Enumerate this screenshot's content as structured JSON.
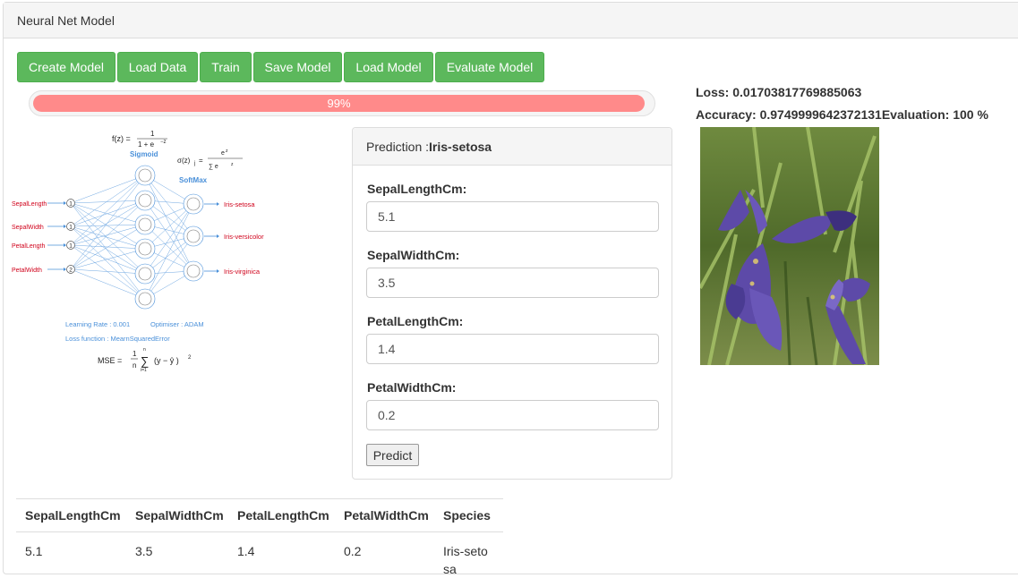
{
  "panel": {
    "title": "Neural Net Model"
  },
  "toolbar": {
    "create_model": "Create Model",
    "load_data": "Load Data",
    "train": "Train",
    "save_model": "Save Model",
    "load_model": "Load Model",
    "evaluate_model": "Evaluate Model"
  },
  "progress": {
    "label": "99%",
    "value": 0.99
  },
  "diagram": {
    "sigmoid_label": "Sigmoid",
    "softmax_label": "SoftMax",
    "inputs": [
      {
        "name": "SepalLength",
        "value": "1"
      },
      {
        "name": "SepalWidth",
        "value": "1"
      },
      {
        "name": "PetalLength",
        "value": "1"
      },
      {
        "name": "PetalWidth",
        "value": "2"
      }
    ],
    "outputs": [
      "Iris-setosa",
      "Iris-versicolor",
      "Iris-virginica"
    ],
    "learning_rate": "Learning Rate : 0.001",
    "optimiser": "Optimiser : ADAM",
    "loss_function": "Loss function : MearnSquaredError"
  },
  "prediction": {
    "title_prefix": "Prediction :",
    "result": "Iris-setosa",
    "fields": [
      {
        "label": "SepalLengthCm:",
        "value": "5.1"
      },
      {
        "label": "SepalWidthCm:",
        "value": "3.5"
      },
      {
        "label": "PetalLengthCm:",
        "value": "1.4"
      },
      {
        "label": "PetalWidthCm:",
        "value": "0.2"
      }
    ],
    "predict_label": "Predict"
  },
  "stats": {
    "loss": "Loss: 0.01703817769885063",
    "accuracy": "Accuracy: 0.9749999642372131Evaluation: 100 %"
  },
  "table": {
    "headers": [
      "SepalLengthCm",
      "SepalWidthCm",
      "PetalLengthCm",
      "PetalWidthCm",
      "Species"
    ],
    "rows": [
      [
        "5.1",
        "3.5",
        "1.4",
        "0.2",
        "Iris-setosa"
      ]
    ]
  },
  "colors": {
    "button_green": "#5cb85c",
    "progress_red": "#ff8a8a",
    "diagram_blue": "#4a90d9",
    "diagram_red": "#d0021b"
  }
}
